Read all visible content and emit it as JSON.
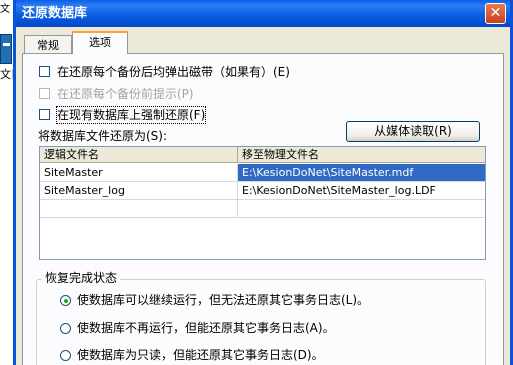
{
  "background": {
    "text_top": "文",
    "text_left": "文目"
  },
  "dialog": {
    "title": "还原数据库",
    "close_glyph": "✕"
  },
  "tabs": [
    {
      "label": "常规"
    },
    {
      "label": "选项"
    }
  ],
  "options": [
    {
      "label": "在还原每个备份后均弹出磁带（如果有）(E)",
      "checked": false,
      "enabled": true
    },
    {
      "label": "在还原每个备份前提示(P)",
      "checked": false,
      "enabled": false
    },
    {
      "label": "在现有数据库上强制还原(F)",
      "checked": false,
      "enabled": true
    }
  ],
  "restore_as_label": "将数据库文件还原为(S):",
  "read_from_media_button": "从媒体读取(R)",
  "file_grid": {
    "columns": [
      "逻辑文件名",
      "移至物理文件名"
    ],
    "rows": [
      [
        "SiteMaster",
        "E:\\KesionDoNet\\SiteMaster.mdf"
      ],
      [
        "SiteMaster_log",
        "E:\\KesionDoNet\\SiteMaster_log.LDF"
      ]
    ]
  },
  "recovery": {
    "group_title": "恢复完成状态",
    "options": [
      {
        "label": "使数据库可以继续运行，但无法还原其它事务日志(L)。",
        "selected": true
      },
      {
        "label": "使数据库不再运行，但能还原其它事务日志(A)。",
        "selected": false
      },
      {
        "label": "使数据库为只读，但能还原其它事务日志(D)。",
        "selected": false
      }
    ]
  },
  "colors": {
    "title_bar": "#0a5be0",
    "selection": "#316ac5",
    "dialog_bg": "#ece9d8"
  }
}
